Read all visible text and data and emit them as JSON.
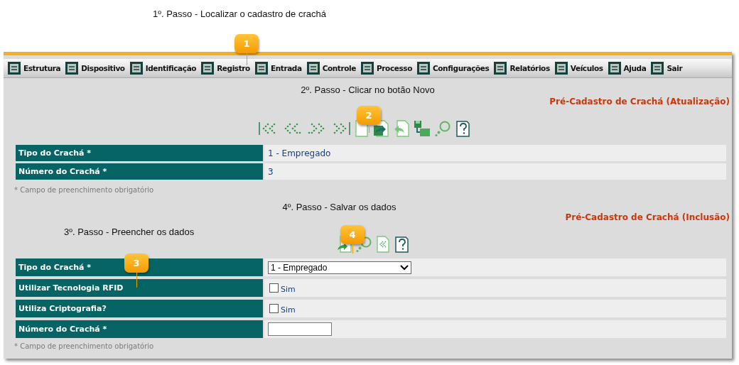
{
  "steps": [
    {
      "text": "1º. Passo - Localizar o cadastro de crachá"
    },
    {
      "text": "2º. Passo - Clicar no botão Novo"
    },
    {
      "text": "3º. Passo - Preencher os dados"
    },
    {
      "text": "4º. Passo - Salvar os dados"
    }
  ],
  "callouts": [
    "1",
    "2",
    "3",
    "4"
  ],
  "menu": [
    "Estrutura",
    "Dispositivo",
    "Identificação",
    "Registro",
    "Entrada",
    "Controle",
    "Processo",
    "Configurações",
    "Relatórios",
    "Veículos",
    "Ajuda",
    "Sair"
  ],
  "update_section": {
    "title": "Pré-Cadastro de Crachá (Atualização)",
    "fields": [
      {
        "label": "Tipo do Crachá *",
        "value": "1 - Empregado"
      },
      {
        "label": "Número do Crachá *",
        "value": "3"
      }
    ],
    "note": "* Campo de preenchimento obrigatório"
  },
  "insert_section": {
    "title": "Pré-Cadastro de Crachá (Inclusão)",
    "fields": [
      {
        "kind": "select",
        "label": "Tipo do Crachá *",
        "value": "1 - Empregado"
      },
      {
        "kind": "checkbox",
        "label": "Utilizar Tecnologia RFID",
        "checked": false,
        "option": "Sim"
      },
      {
        "kind": "checkbox",
        "label": "Utiliza Criptografia?",
        "checked": false,
        "option": "Sim"
      },
      {
        "kind": "text",
        "label": "Número do Crachá *"
      }
    ],
    "note": "* Campo de preenchimento obrigatório"
  }
}
